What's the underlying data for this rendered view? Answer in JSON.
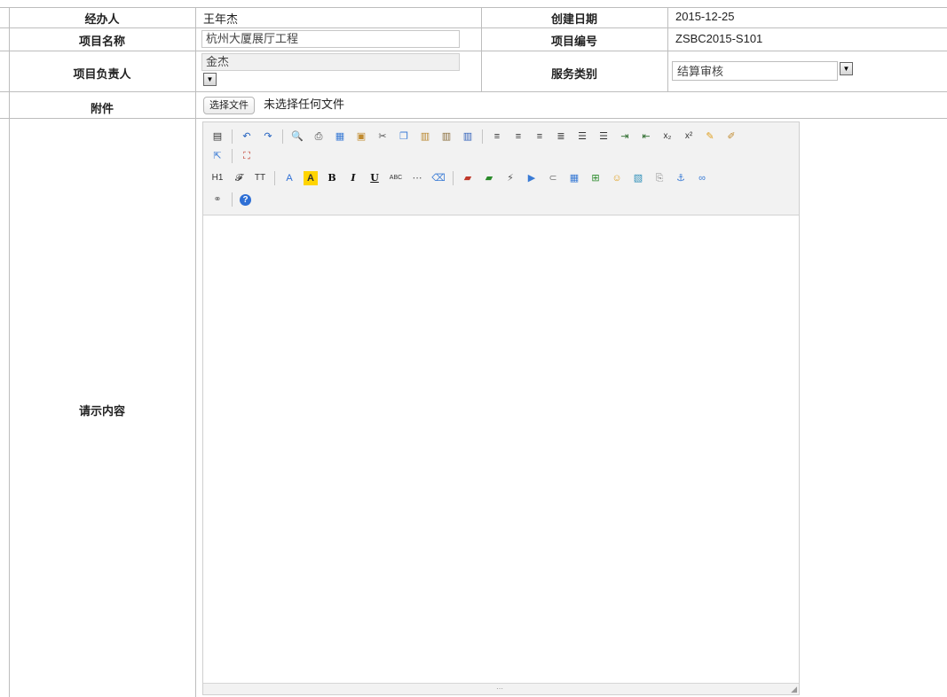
{
  "form": {
    "handler_label": "经办人",
    "handler_value": "王年杰",
    "created_label": "创建日期",
    "created_value": "2015-12-25",
    "project_name_label": "项目名称",
    "project_name_value": "杭州大厦展厅工程",
    "project_no_label": "项目编号",
    "project_no_value": "ZSBC2015-S101",
    "leader_label": "项目负责人",
    "leader_value": "金杰",
    "service_label": "服务类别",
    "service_value": "结算审核",
    "attachment_label": "附件",
    "file_button": "选择文件",
    "file_status": "未选择任何文件",
    "content_label": "请示内容"
  },
  "editor": {
    "row1": [
      "source-icon",
      "sep",
      "undo-icon",
      "redo-icon",
      "sep",
      "preview-icon",
      "print-icon",
      "template-icon",
      "code-icon",
      "cut-icon",
      "copy-icon",
      "paste-icon",
      "paste-text-icon",
      "paste-word-icon",
      "sep",
      "align-left-icon",
      "align-center-icon",
      "align-right-icon",
      "justify-icon",
      "ordered-list-icon",
      "unordered-list-icon",
      "indent-icon",
      "outdent-icon",
      "subscript-icon",
      "superscript-icon",
      "clear-format-icon",
      "quick-format-icon"
    ],
    "row2": [
      "select-all-icon",
      "sep",
      "fullscreen-icon"
    ],
    "row3": [
      "heading-icon",
      "font-family-icon",
      "font-size-icon",
      "sep",
      "font-color-icon",
      "highlight-icon",
      "bold-icon",
      "italic-icon",
      "underline-icon",
      "strikethrough-icon",
      "horizontal-rule-icon",
      "remove-format-icon",
      "sep",
      "image-icon",
      "multi-image-icon",
      "flash-icon",
      "media-icon",
      "attachment-icon",
      "table-icon",
      "insert-row-icon",
      "emoticon-icon",
      "map-icon",
      "pagebreak-icon",
      "anchor-icon",
      "link-icon"
    ],
    "row4": [
      "unlink-icon",
      "sep",
      "help-icon"
    ],
    "colors": {
      "toolbar_bg": "#f2f2f2",
      "border": "#cfcfcf"
    }
  }
}
